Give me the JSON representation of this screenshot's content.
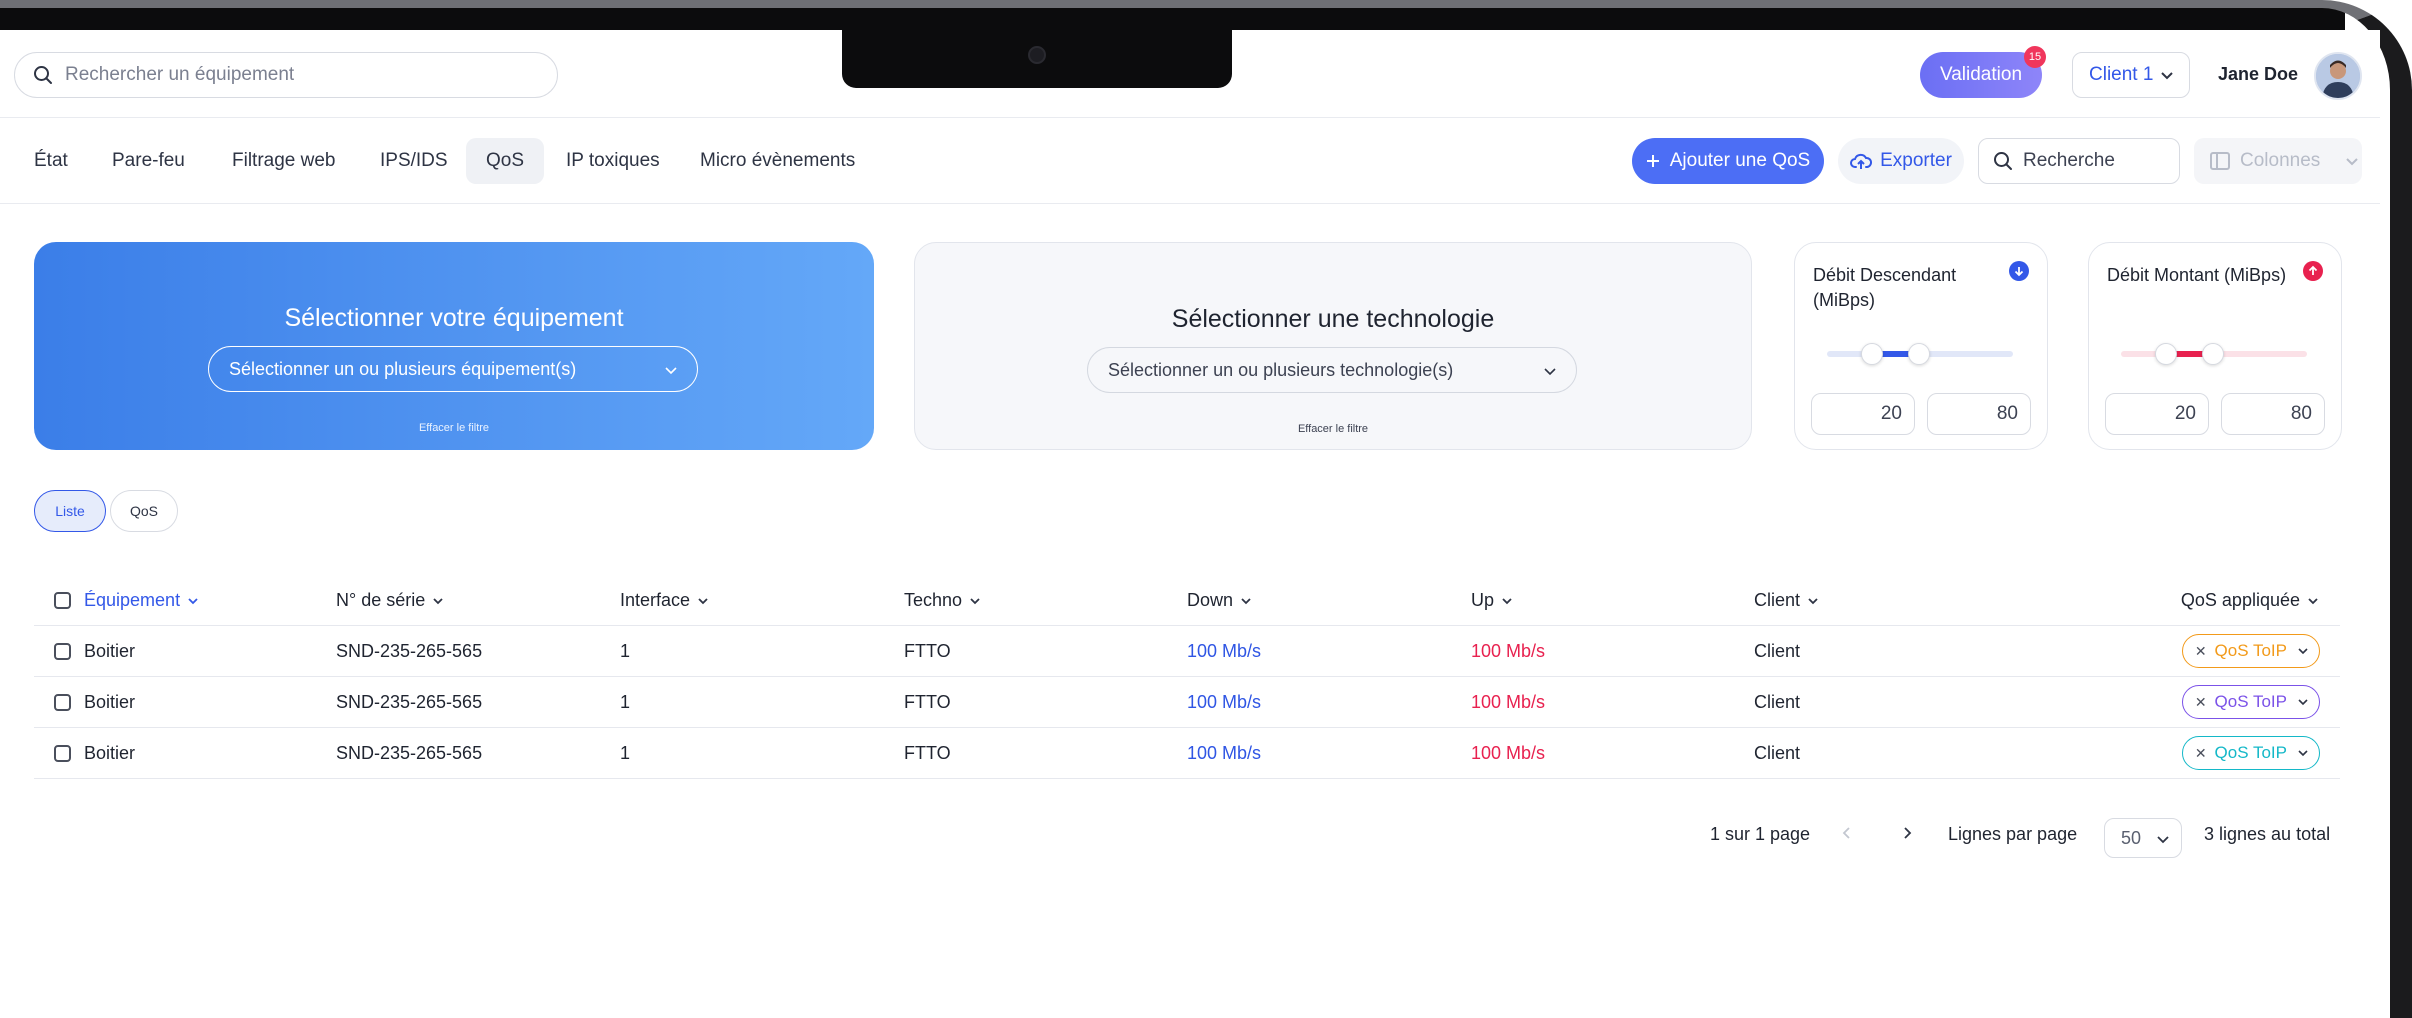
{
  "topbar": {
    "search_placeholder": "Rechercher un équipement",
    "validation_label": "Validation",
    "validation_count": "15",
    "client_selected": "Client 1",
    "user_name": "Jane Doe"
  },
  "tabs": [
    {
      "label": "État"
    },
    {
      "label": "Pare-feu"
    },
    {
      "label": "Filtrage web"
    },
    {
      "label": "IPS/IDS"
    },
    {
      "label": "QoS",
      "active": true
    },
    {
      "label": "IP toxiques"
    },
    {
      "label": "Micro évènements"
    }
  ],
  "toolbar": {
    "add_label": "Ajouter une QoS",
    "export_label": "Exporter",
    "search_placeholder": "Recherche",
    "columns_label": "Colonnes"
  },
  "filters": {
    "equipment": {
      "title": "Sélectionner votre équipement",
      "select_placeholder": "Sélectionner un ou plusieurs équipement(s)",
      "clear": "Effacer le filtre"
    },
    "technology": {
      "title": "Sélectionner une technologie",
      "select_placeholder": "Sélectionner un ou plusieurs technologie(s)",
      "clear": "Effacer le filtre"
    },
    "down": {
      "title": "Débit Descendant (MiBps)",
      "min": "20",
      "max": "80",
      "color": "#3358e8"
    },
    "up": {
      "title": "Débit Montant (MiBps)",
      "min": "20",
      "max": "80",
      "color": "#e8214f"
    }
  },
  "view": {
    "list_label": "Liste",
    "qos_label": "QoS"
  },
  "table": {
    "headers": [
      "Équipement",
      "N° de série",
      "Interface",
      "Techno",
      "Down",
      "Up",
      "Client",
      "QoS appliquée"
    ],
    "rows": [
      {
        "equipment": "Boitier",
        "serial": "SND-235-265-565",
        "interface": "1",
        "techno": "FTTO",
        "down": "100 Mb/s",
        "up": "100 Mb/s",
        "client": "Client",
        "qos": "QoS ToIP",
        "qos_color": "#f29a1a"
      },
      {
        "equipment": "Boitier",
        "serial": "SND-235-265-565",
        "interface": "1",
        "techno": "FTTO",
        "down": "100 Mb/s",
        "up": "100 Mb/s",
        "client": "Client",
        "qos": "QoS ToIP",
        "qos_color": "#7b52e8"
      },
      {
        "equipment": "Boitier",
        "serial": "SND-235-265-565",
        "interface": "1",
        "techno": "FTTO",
        "down": "100 Mb/s",
        "up": "100 Mb/s",
        "client": "Client",
        "qos": "QoS ToIP",
        "qos_color": "#14b8c8"
      }
    ]
  },
  "pagination": {
    "page_info": "1 sur 1 page",
    "rows_per_page_label": "Lignes par page",
    "rows_per_page": "50",
    "total": "3 lignes au total"
  }
}
